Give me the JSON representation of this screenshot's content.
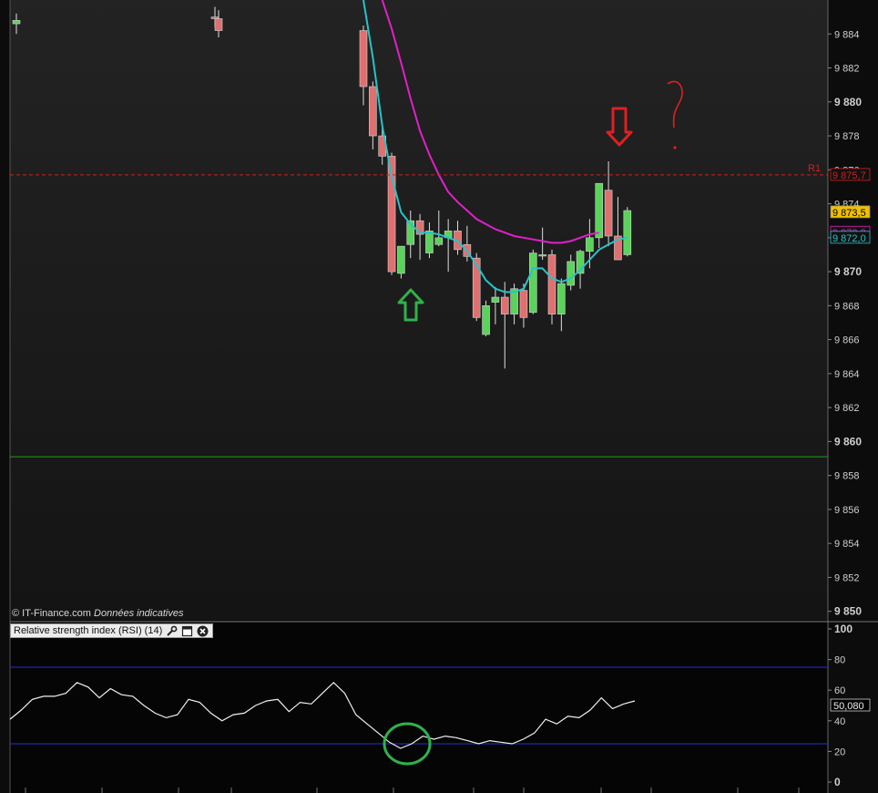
{
  "copyright": {
    "source": "© IT-Finance.com",
    "note": "Données indicatives"
  },
  "rsi_panel": {
    "title": "Relative strength index (RSI) (14)"
  },
  "annotations": {
    "question_mark": "?"
  },
  "colors": {
    "background": "#111111",
    "up_candle": "#5ad35a",
    "down_candle": "#e07070",
    "ma_fast": "#25c4c8",
    "ma_slow": "#e020c8",
    "resistance": "#d02020",
    "support": "#1ea01e",
    "rsi_line": "#f0f0f0",
    "rsi_bands": "#2a2ad0",
    "arrow_up": "#2fb24a",
    "arrow_down": "#e02020",
    "circle": "#2fb24a"
  },
  "icons": [
    "wrench-icon",
    "window-icon",
    "close-icon",
    "arrow-up-icon",
    "arrow-down-icon",
    "question-mark"
  ],
  "chart_data": [
    {
      "type": "candlestick",
      "ylim": [
        9849.5,
        9886
      ],
      "yticks": [
        {
          "value": 9884,
          "label": "9 884"
        },
        {
          "value": 9882,
          "label": "9 882"
        },
        {
          "value": 9880,
          "label": "9 880"
        },
        {
          "value": 9878,
          "label": "9 878"
        },
        {
          "value": 9876,
          "label": "9 876"
        },
        {
          "value": 9874,
          "label": "9 874"
        },
        {
          "value": 9872,
          "label": "9 872"
        },
        {
          "value": 9870,
          "label": "9 870"
        },
        {
          "value": 9868,
          "label": "9 868"
        },
        {
          "value": 9866,
          "label": "9 866"
        },
        {
          "value": 9864,
          "label": "9 864"
        },
        {
          "value": 9862,
          "label": "9 862"
        },
        {
          "value": 9860,
          "label": "9 860"
        },
        {
          "value": 9858,
          "label": "9 858"
        },
        {
          "value": 9856,
          "label": "9 856"
        },
        {
          "value": 9854,
          "label": "9 854"
        },
        {
          "value": 9852,
          "label": "9 852"
        },
        {
          "value": 9850,
          "label": "9 850"
        }
      ],
      "candles": [
        {
          "o": 9884.6,
          "h": 9885.2,
          "l": 9884.0,
          "c": 9884.8
        },
        {
          "o": 9885.0,
          "h": 9885.6,
          "l": 9884.4,
          "c": 9884.9
        },
        {
          "o": 9884.9,
          "h": 9885.4,
          "l": 9883.8,
          "c": 9884.2
        },
        {
          "o": 9884.2,
          "h": 9884.5,
          "l": 9879.8,
          "c": 9880.9
        },
        {
          "o": 9880.9,
          "h": 9881.2,
          "l": 9877.2,
          "c": 9878.0
        },
        {
          "o": 9878.0,
          "h": 9878.6,
          "l": 9876.3,
          "c": 9876.8
        },
        {
          "o": 9876.8,
          "h": 9877.0,
          "l": 9869.8,
          "c": 9870.0
        },
        {
          "o": 9869.9,
          "h": 9871.4,
          "l": 9869.6,
          "c": 9871.5
        },
        {
          "o": 9871.6,
          "h": 9873.6,
          "l": 9870.8,
          "c": 9873.0
        },
        {
          "o": 9873.0,
          "h": 9873.4,
          "l": 9870.7,
          "c": 9872.2
        },
        {
          "o": 9871.1,
          "h": 9872.9,
          "l": 9870.8,
          "c": 9872.4
        },
        {
          "o": 9871.6,
          "h": 9873.6,
          "l": 9871.5,
          "c": 9872.0
        },
        {
          "o": 9872.0,
          "h": 9873.1,
          "l": 9870.0,
          "c": 9872.4
        },
        {
          "o": 9872.4,
          "h": 9873.0,
          "l": 9871.0,
          "c": 9871.3
        },
        {
          "o": 9871.6,
          "h": 9872.7,
          "l": 9870.6,
          "c": 9870.9
        },
        {
          "o": 9870.8,
          "h": 9871.1,
          "l": 9867.1,
          "c": 9867.3
        },
        {
          "o": 9866.3,
          "h": 9868.3,
          "l": 9866.2,
          "c": 9868.0
        },
        {
          "o": 9868.2,
          "h": 9869.1,
          "l": 9866.9,
          "c": 9868.5
        },
        {
          "o": 9868.5,
          "h": 9869.4,
          "l": 9864.3,
          "c": 9867.5
        },
        {
          "o": 9867.5,
          "h": 9869.3,
          "l": 9866.9,
          "c": 9869.0
        },
        {
          "o": 9868.9,
          "h": 9869.3,
          "l": 9866.7,
          "c": 9867.3
        },
        {
          "o": 9867.6,
          "h": 9871.3,
          "l": 9867.5,
          "c": 9871.1
        },
        {
          "o": 9871.0,
          "h": 9872.6,
          "l": 9870.7,
          "c": 9871.0
        },
        {
          "o": 9871.0,
          "h": 9871.3,
          "l": 9866.9,
          "c": 9867.5
        },
        {
          "o": 9867.5,
          "h": 9869.6,
          "l": 9866.5,
          "c": 9869.3
        },
        {
          "o": 9869.2,
          "h": 9871.0,
          "l": 9868.9,
          "c": 9870.6
        },
        {
          "o": 9869.9,
          "h": 9871.3,
          "l": 9869.0,
          "c": 9871.2
        },
        {
          "o": 9871.2,
          "h": 9873.1,
          "l": 9870.2,
          "c": 9872.0
        },
        {
          "o": 9872.0,
          "h": 9874.4,
          "l": 9871.4,
          "c": 9875.2
        },
        {
          "o": 9874.8,
          "h": 9876.5,
          "l": 9871.5,
          "c": 9872.1
        },
        {
          "o": 9872.1,
          "h": 9874.4,
          "l": 9870.7,
          "c": 9870.7
        },
        {
          "o": 9871.0,
          "h": 9873.8,
          "l": 9870.9,
          "c": 9873.6
        }
      ],
      "ma_fast": [
        [
          3,
          9886.0
        ],
        [
          4,
          9882.6
        ],
        [
          5,
          9878.6
        ],
        [
          6,
          9875.6
        ],
        [
          7,
          9873.5
        ],
        [
          8,
          9872.8
        ],
        [
          9,
          9872.3
        ],
        [
          10,
          9872.3
        ],
        [
          11,
          9872.2
        ],
        [
          12,
          9872.0
        ],
        [
          13,
          9871.8
        ],
        [
          14,
          9871.2
        ],
        [
          15,
          9870.4
        ],
        [
          16,
          9869.5
        ],
        [
          17,
          9869.0
        ],
        [
          18,
          9868.8
        ],
        [
          19,
          9868.8
        ],
        [
          20,
          9869.0
        ],
        [
          21,
          9870.2
        ],
        [
          22,
          9870.2
        ],
        [
          23,
          9869.6
        ],
        [
          24,
          9869.4
        ],
        [
          25,
          9869.6
        ],
        [
          26,
          9870.1
        ],
        [
          27,
          9870.7
        ],
        [
          28,
          9871.3
        ],
        [
          29,
          9871.6
        ],
        [
          30,
          9871.9
        ],
        [
          31,
          9872.0
        ]
      ],
      "ma_slow": [
        [
          5,
          9886.0
        ],
        [
          6,
          9884.3
        ],
        [
          7,
          9882.3
        ],
        [
          8,
          9880.2
        ],
        [
          9,
          9878.3
        ],
        [
          10,
          9876.9
        ],
        [
          11,
          9875.7
        ],
        [
          12,
          9874.7
        ],
        [
          13,
          9874.1
        ],
        [
          14,
          9873.6
        ],
        [
          15,
          9873.1
        ],
        [
          16,
          9872.8
        ],
        [
          17,
          9872.5
        ],
        [
          18,
          9872.3
        ],
        [
          19,
          9872.1
        ],
        [
          20,
          9872.0
        ],
        [
          21,
          9871.9
        ],
        [
          22,
          9871.8
        ],
        [
          23,
          9871.7
        ],
        [
          24,
          9871.7
        ],
        [
          25,
          9871.8
        ],
        [
          26,
          9872.0
        ],
        [
          27,
          9872.2
        ],
        [
          28,
          9872.3
        ]
      ],
      "levels": {
        "resistance": {
          "label": "R1",
          "value": 9875.7,
          "text": "9 875,7"
        },
        "support": {
          "value": 9859.1
        }
      },
      "last_values": [
        {
          "text": "9 873,5",
          "value": 9873.5,
          "bg": "#f0c000",
          "fg": "#000000"
        },
        {
          "text": "9 872,3",
          "value": 9872.3,
          "bg": "#111111",
          "fg": "#e020c8"
        },
        {
          "text": "9 872,0",
          "value": 9872.0,
          "bg": "#111111",
          "fg": "#25c4c8"
        }
      ]
    },
    {
      "type": "line",
      "title": "Relative strength index (RSI) (14)",
      "ylim": [
        0,
        100
      ],
      "yticks": [
        0,
        20,
        40,
        60,
        80,
        100
      ],
      "bands": [
        25,
        75
      ],
      "last_value": "50,080",
      "values": [
        41,
        47,
        54,
        56,
        56,
        58,
        65,
        62,
        55,
        61,
        57,
        56,
        50,
        45,
        42,
        44,
        54,
        52,
        45,
        40,
        44,
        45,
        50,
        53,
        54,
        46,
        52,
        51,
        58,
        65,
        58,
        44,
        38,
        32,
        26,
        22,
        25,
        30,
        28,
        30,
        29,
        27,
        25,
        27,
        26,
        25,
        28,
        32,
        41,
        38,
        43,
        42,
        47,
        55,
        48,
        51,
        53
      ]
    }
  ]
}
